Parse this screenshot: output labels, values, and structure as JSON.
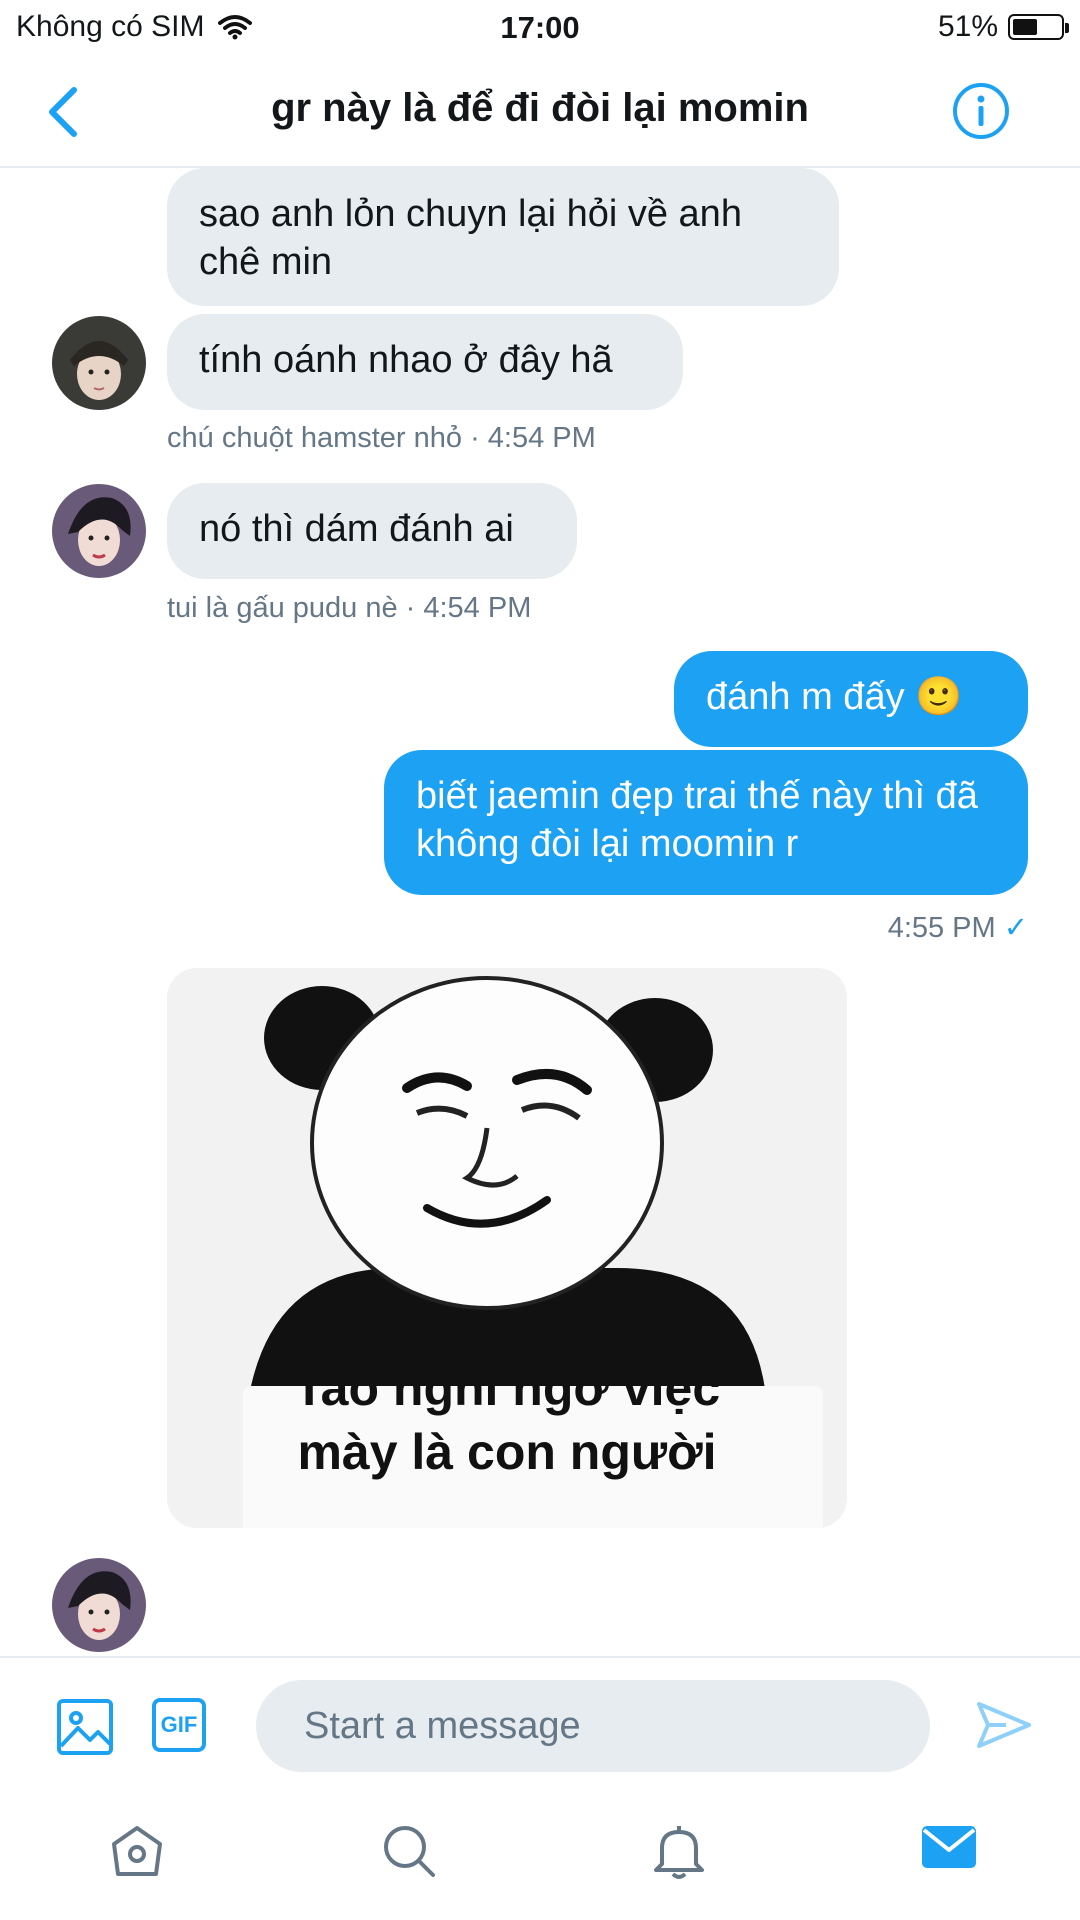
{
  "status_bar": {
    "carrier": "Không có SIM",
    "time": "17:00",
    "battery_percent": "51%"
  },
  "header": {
    "title": "gr này là để đi đòi lại momin"
  },
  "messages": [
    {
      "text": "sao anh lỏn chuyn lại hỏi về anh chê min"
    },
    {
      "text": "tính oánh nhao ở đây hã"
    },
    {
      "meta": "chú chuột hamster nhỏ · 4:54 PM"
    },
    {
      "text": "nó thì dám đánh ai"
    },
    {
      "meta": "tui là gấu pudu nè · 4:54 PM"
    },
    {
      "text": "đánh m đấy 🙂"
    },
    {
      "text": "biết jaemin đẹp trai thế này thì đã không đòi lại moomin r"
    },
    {
      "meta": "4:55 PM"
    },
    {
      "image_caption": "Tao nghi ngờ việc mày là con người"
    }
  ],
  "composer": {
    "placeholder": "Start a message",
    "gif_label": "GIF"
  },
  "colors": {
    "accent": "#1da1f2",
    "incoming_bubble": "#e6ecf0"
  },
  "icons": {
    "header": [
      "back-chevron-icon",
      "info-icon"
    ],
    "composer": [
      "image-icon",
      "gif-icon",
      "send-icon"
    ],
    "tabs": [
      "home-icon",
      "search-icon",
      "notifications-icon",
      "messages-icon"
    ]
  }
}
